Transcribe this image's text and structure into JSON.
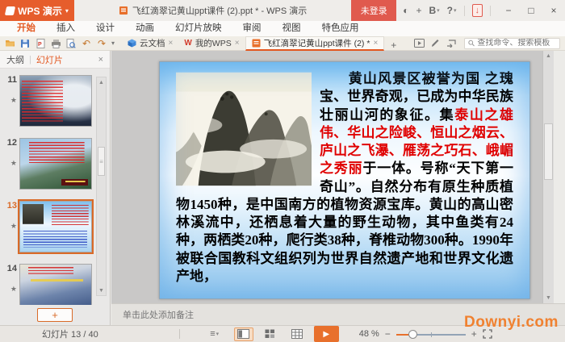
{
  "titlebar": {
    "logo": "WPS 演示",
    "doc_title": "飞红滴翠记黄山ppt课件 (2).ppt * - WPS 演示",
    "login_label": "未登录"
  },
  "ribbon": {
    "tabs": [
      "开始",
      "插入",
      "设计",
      "动画",
      "幻灯片放映",
      "审阅",
      "视图",
      "特色应用"
    ],
    "active_tab": "开始"
  },
  "doc_tabs": {
    "items": [
      "云文档",
      "我的WPS",
      "飞红滴翠记黄山ppt课件 (2) *"
    ],
    "search_placeholder": "查找命令、搜索模板"
  },
  "sidebar": {
    "tab_outline": "大纲",
    "tab_slides": "幻灯片",
    "slides": [
      {
        "number": "11"
      },
      {
        "number": "12"
      },
      {
        "number": "13",
        "selected": true
      },
      {
        "number": "14"
      }
    ]
  },
  "slide": {
    "text_black_1": "黄山风景区被誉为国 之瑰宝、世界奇观，已成为中华民族壮丽山河的象征。集",
    "text_red": "泰山之雄伟、华山之险峻、恒山之烟云、庐山之飞瀑、雁荡之巧石、峨嵋之秀丽",
    "text_black_2": "于一体。号称“天下第一奇山”。自然分布有原生种质植物1450种，是中国南方的植物资源宝库。黄山的高山密林溪流中，还栖息着大量的野生动物，其中鱼类有24种，两栖类20种，爬行类38种，脊椎动物300种。1990年被联合国教科文组织列为世界自然遗产地和世界文化遗产地，"
  },
  "notes": {
    "placeholder": "单击此处添加备注"
  },
  "statusbar": {
    "slide_counter": "幻灯片 13 / 40",
    "zoom_level": "48 %"
  },
  "watermark": "Downyi.com",
  "icons": {
    "dropdown": "▾",
    "undo": "↶",
    "redo": "↷",
    "close": "×",
    "minimize": "−",
    "maximize": "□",
    "star": "★",
    "plus": "+",
    "up_arrow": "▲",
    "down_arrow": "▼",
    "grip": "≡",
    "play": "▶",
    "download": "↓",
    "member": "◐",
    "skin": "B",
    "help": "?",
    "wps_w": "W",
    "minus": "−",
    "notes_toggle": "≡"
  }
}
